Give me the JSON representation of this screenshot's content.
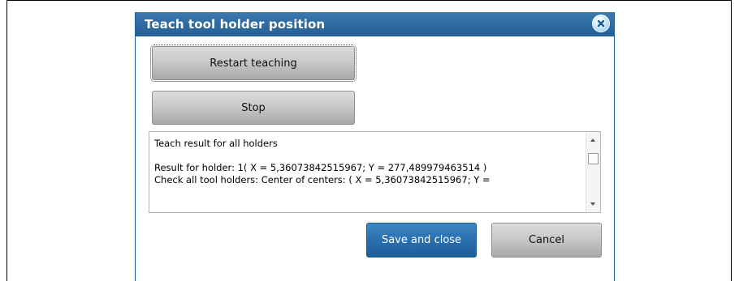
{
  "dialog": {
    "title": "Teach tool holder position",
    "close_icon": "close-icon"
  },
  "buttons": {
    "restart_label": "Restart teaching",
    "stop_label": "Stop",
    "save_label": "Save and close",
    "cancel_label": "Cancel"
  },
  "result": {
    "text": "Teach result for all holders\n\nResult for holder: 1( X = 5,36073842515967; Y = 277,489979463514 )\nCheck all tool holders: Center of centers: ( X = 5,36073842515967; Y ="
  },
  "colors": {
    "titlebar": "#2a67a0",
    "primary_button": "#2a6fad",
    "close_button": "#7ec3f6"
  }
}
